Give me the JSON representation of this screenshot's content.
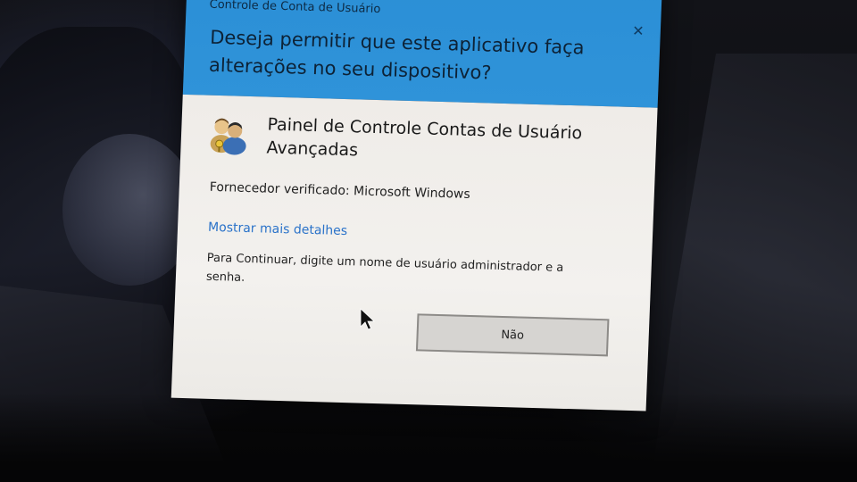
{
  "window": {
    "title": "Controle de Conta de Usuário",
    "close_symbol": "✕"
  },
  "header": {
    "question_line1": "Deseja permitir que este aplicativo faça",
    "question_line2": "alterações no seu dispositivo?"
  },
  "app": {
    "icon": "users-icon",
    "name_line1": "Painel de Controle Contas de Usuário",
    "name_line2": "Avançadas"
  },
  "publisher": "Fornecedor verificado: Microsoft Windows",
  "details_link": "Mostrar mais detalhes",
  "instruction": "Para Continuar, digite um nome de usuário administrador e a senha.",
  "buttons": {
    "no_label": "Não"
  },
  "colors": {
    "header": "#2f93d9",
    "body": "#f0eeea",
    "link": "#2b73c9"
  }
}
